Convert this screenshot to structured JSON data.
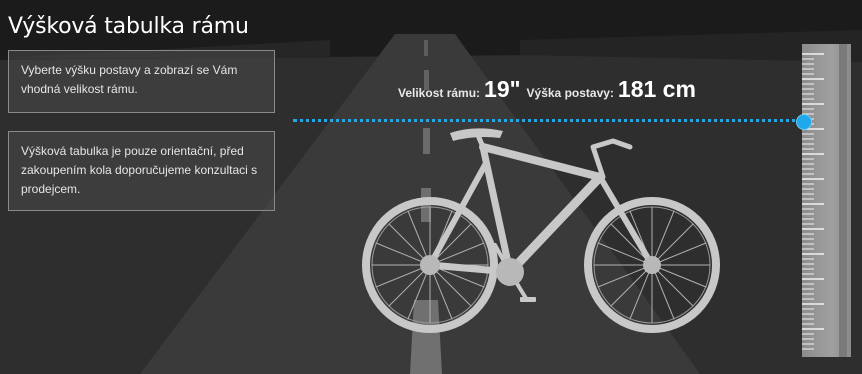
{
  "title": "Výšková tabulka rámu",
  "info_boxes": [
    {
      "text": "Vyberte výšku postavy a zobrazí se Vám vhodná velikost rámu."
    },
    {
      "text": "Výšková tabulka je pouze orientační, před zakoupením kola doporučujeme konzultaci s prodejcem."
    }
  ],
  "readout": {
    "frame_label": "Velikost rámu:",
    "frame_value": "19\"",
    "height_label": "Výška postavy:",
    "height_value": "181 cm"
  },
  "colors": {
    "accent": "#1fa9ea",
    "bike": "#c8c8c8",
    "ruler": "#9a9a9a"
  },
  "icons": {
    "bike": "bicycle-silhouette",
    "slider": "height-slider-handle"
  }
}
